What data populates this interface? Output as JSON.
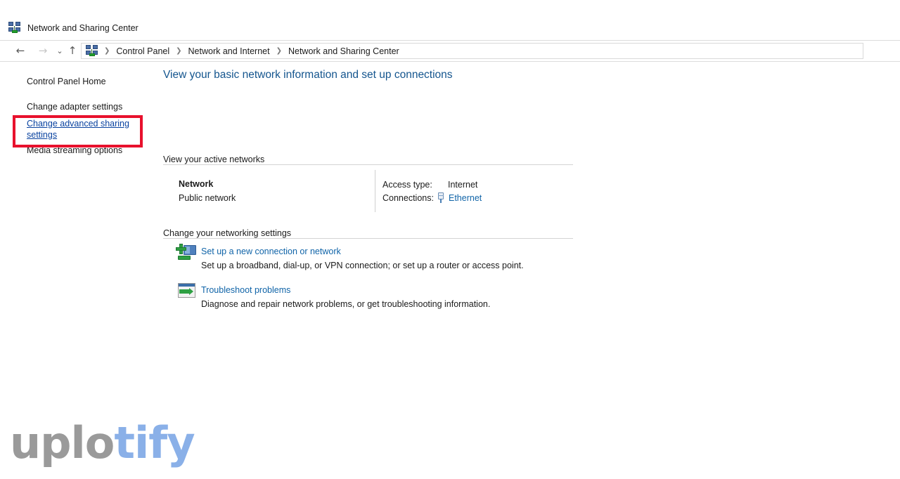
{
  "window": {
    "title": "Network and Sharing Center",
    "title_icon": "network-sharing-icon"
  },
  "navbar": {
    "back_icon": "arrow-left-icon",
    "forward_icon": "arrow-right-icon",
    "recent_icon": "chevron-down-icon",
    "up_icon": "arrow-up-icon",
    "address_icon": "network-sharing-icon",
    "separator": "❯",
    "breadcrumbs": [
      "Control Panel",
      "Network and Internet",
      "Network and Sharing Center"
    ]
  },
  "sidebar": {
    "items": [
      {
        "label": "Control Panel Home",
        "link": false
      },
      {
        "label": "Change adapter settings",
        "link": false
      },
      {
        "label": "Change advanced sharing settings",
        "link": true,
        "highlighted": true
      },
      {
        "label": "Media streaming options",
        "link": false
      }
    ]
  },
  "annotation": {
    "highlight_color": "#e8112d",
    "target_label": "Change advanced sharing settings"
  },
  "content": {
    "heading": "View your basic network information and set up connections",
    "active_networks": {
      "group_label": "View your active networks",
      "network_name": "Network",
      "network_type": "Public network",
      "details": [
        {
          "key": "Access type:",
          "value": "Internet",
          "is_link": false
        },
        {
          "key": "Connections:",
          "value": "Ethernet",
          "is_link": true,
          "icon": "ethernet-plug-icon"
        }
      ]
    },
    "networking_settings": {
      "group_label": "Change your networking settings",
      "tasks": [
        {
          "icon": "new-connection-icon",
          "link": "Set up a new connection or network",
          "description": "Set up a broadband, dial-up, or VPN connection; or set up a router or access point."
        },
        {
          "icon": "troubleshoot-icon",
          "link": "Troubleshoot problems",
          "description": "Diagnose and repair network problems, or get troubleshooting information."
        }
      ]
    }
  },
  "watermark": {
    "part_a": "uplo",
    "part_b": "tify",
    "color_a": "#9a9a9a",
    "color_b": "#8ab0e8"
  }
}
